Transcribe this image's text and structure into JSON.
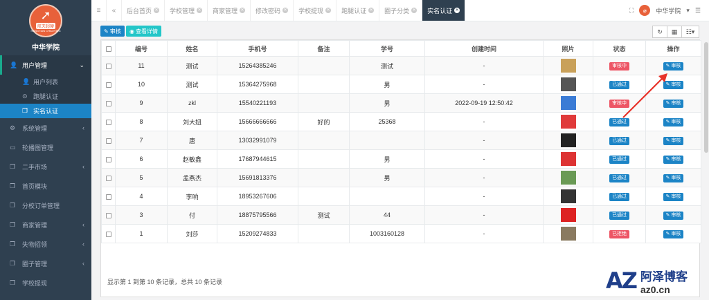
{
  "sidebar": {
    "logo_text": "航天超硬",
    "logo_sub": "HANGTIAN CHAOYING",
    "school_name": "中华学院",
    "user_mgmt": "用户管理",
    "sub_items": [
      "用户列表",
      "跑腿认证",
      "实名认证"
    ],
    "items": [
      "系统管理",
      "轮播图管理",
      "二手市场",
      "首页模块",
      "分校订单管理",
      "商家管理",
      "失物招领",
      "圈子管理",
      "学校提现"
    ]
  },
  "topbar": {
    "tabs": [
      "后台首页",
      "学校管理",
      "商家管理",
      "修改密码",
      "学校提现",
      "跑腿认证",
      "圈子分类",
      "实名认证"
    ],
    "user_name": "中华学院"
  },
  "toolbar": {
    "audit_label": "审核",
    "view_detail_label": "查看详情"
  },
  "table": {
    "headers": [
      "编号",
      "姓名",
      "手机号",
      "备注",
      "学号",
      "创建时间",
      "照片",
      "状态",
      "操作"
    ],
    "rows": [
      {
        "id": "11",
        "name": "测试",
        "phone": "15264385246",
        "note": "",
        "student_no": "测试",
        "created": "-",
        "status": "审核中",
        "status_type": "red",
        "action": "审核"
      },
      {
        "id": "10",
        "name": "测试",
        "phone": "15364275968",
        "note": "",
        "student_no": "男",
        "created": "-",
        "status": "已通过",
        "status_type": "blue",
        "action": "审核"
      },
      {
        "id": "9",
        "name": "zkl",
        "phone": "15540221193",
        "note": "",
        "student_no": "男",
        "created": "2022-09-19 12:50:42",
        "status": "审核中",
        "status_type": "red",
        "action": "审核"
      },
      {
        "id": "8",
        "name": "刘大妞",
        "phone": "15666666666",
        "note": "好的",
        "student_no": "25368",
        "created": "-",
        "status": "已通过",
        "status_type": "blue",
        "action": "审核"
      },
      {
        "id": "7",
        "name": "唐",
        "phone": "13032991079",
        "note": "",
        "student_no": "",
        "created": "-",
        "status": "已通过",
        "status_type": "blue",
        "action": "审核"
      },
      {
        "id": "6",
        "name": "赵敏鑫",
        "phone": "17687944615",
        "note": "",
        "student_no": "男",
        "created": "-",
        "status": "已通过",
        "status_type": "blue",
        "action": "审核"
      },
      {
        "id": "5",
        "name": "孟燕杰",
        "phone": "15691813376",
        "note": "",
        "student_no": "男",
        "created": "-",
        "status": "已通过",
        "status_type": "blue",
        "action": "审核"
      },
      {
        "id": "4",
        "name": "李响",
        "phone": "18953267606",
        "note": "",
        "student_no": "",
        "created": "-",
        "status": "已通过",
        "status_type": "blue",
        "action": "审核"
      },
      {
        "id": "3",
        "name": "付",
        "phone": "18875795566",
        "note": "测试",
        "student_no": "44",
        "created": "-",
        "status": "已通过",
        "status_type": "blue",
        "action": "审核"
      },
      {
        "id": "1",
        "name": "刘莎",
        "phone": "15209274833",
        "note": "",
        "student_no": "1003160128",
        "created": "-",
        "status": "已拒绝",
        "status_type": "red",
        "action": "审核"
      }
    ]
  },
  "pagination_info": "显示第 1 到第 10 条记录，总共 10 条记录",
  "watermark": {
    "logo": "AZ",
    "cn": "阿泽博客",
    "url": "az0.cn"
  },
  "colors": {
    "sidebar_bg": "#2f4050",
    "active_blue": "#1c84c6",
    "info_teal": "#23c6c8",
    "danger_red": "#ed5565",
    "brand_orange": "#e8613a"
  }
}
